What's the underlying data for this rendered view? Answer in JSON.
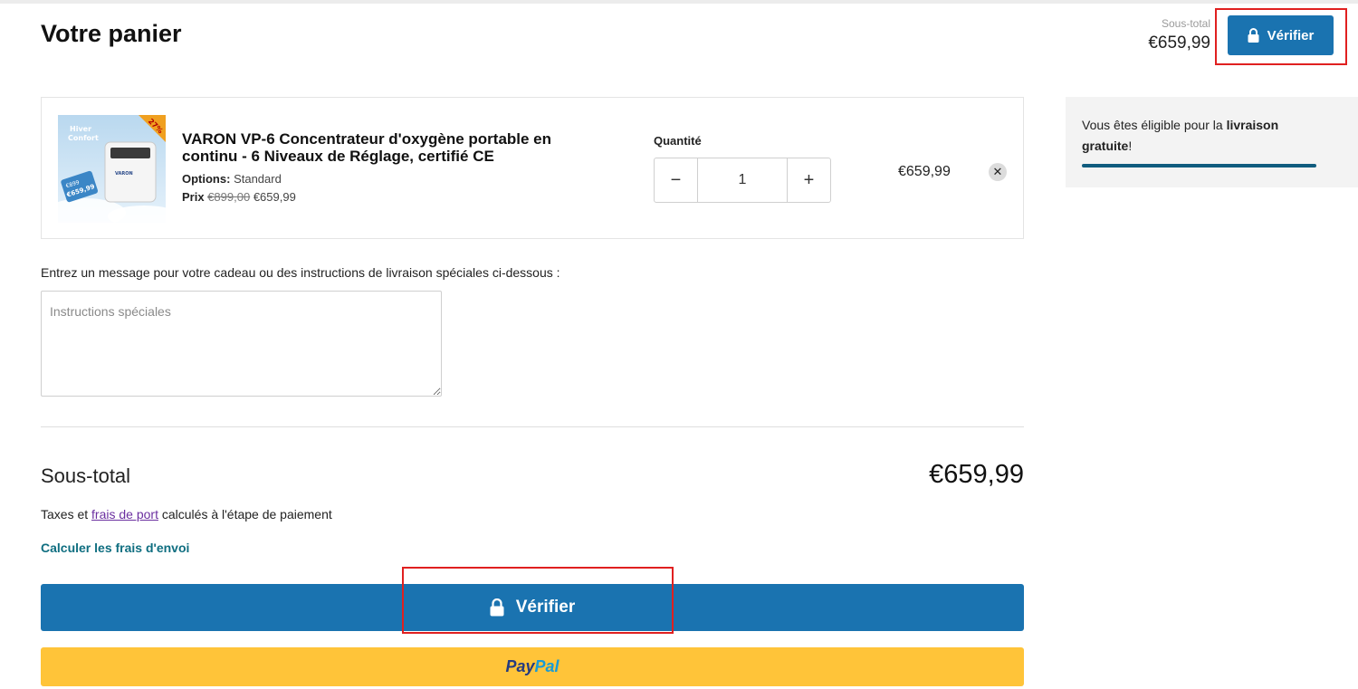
{
  "header": {
    "title": "Votre panier",
    "subtotal_label": "Sous-total",
    "subtotal_value": "€659,99",
    "verify_label": "Vérifier"
  },
  "cart_item": {
    "image_badge": "27%",
    "image_overlay_lines": [
      "Hiver",
      "Confort"
    ],
    "image_tag_lines": [
      "€899",
      "€659,99"
    ],
    "image_brand": "VARON",
    "title": "VARON VP-6 Concentrateur d'oxygène portable en continu - 6 Niveaux de Réglage, certifié CE",
    "options_label": "Options:",
    "options_value": "Standard",
    "price_label": "Prix",
    "price_original": "€899,00",
    "price_sale": "€659,99",
    "quantity_label": "Quantité",
    "quantity_minus": "−",
    "quantity_value": "1",
    "quantity_plus": "+",
    "line_total": "€659,99",
    "remove_symbol": "✕"
  },
  "shipping_notice": {
    "text_before": "Vous êtes éligible pour la ",
    "text_bold": "livraison gratuite",
    "text_after": "!",
    "progress": 1.0
  },
  "note": {
    "label": "Entrez un message pour votre cadeau ou des instructions de livraison spéciales ci-dessous :",
    "placeholder": "Instructions spéciales"
  },
  "summary": {
    "subtotal_label": "Sous-total",
    "subtotal_value": "€659,99",
    "tax_before": "Taxes et ",
    "tax_link": "frais de port",
    "tax_after": " calculés à l'étape de paiement",
    "calc_shipping": "Calculer les frais d'envoi",
    "checkout_label": "Vérifier",
    "paypal_part1": "Pay",
    "paypal_part2": "Pal"
  },
  "colors": {
    "primary_button": "#1a73b0",
    "paypal_yellow": "#ffc439",
    "highlight_red": "#e02020",
    "progress_bar": "#105c7e",
    "link_purple": "#6b2fa0",
    "teal_link": "#0f6e80"
  },
  "icons": {
    "lock": "lock-icon",
    "remove": "close-icon"
  }
}
